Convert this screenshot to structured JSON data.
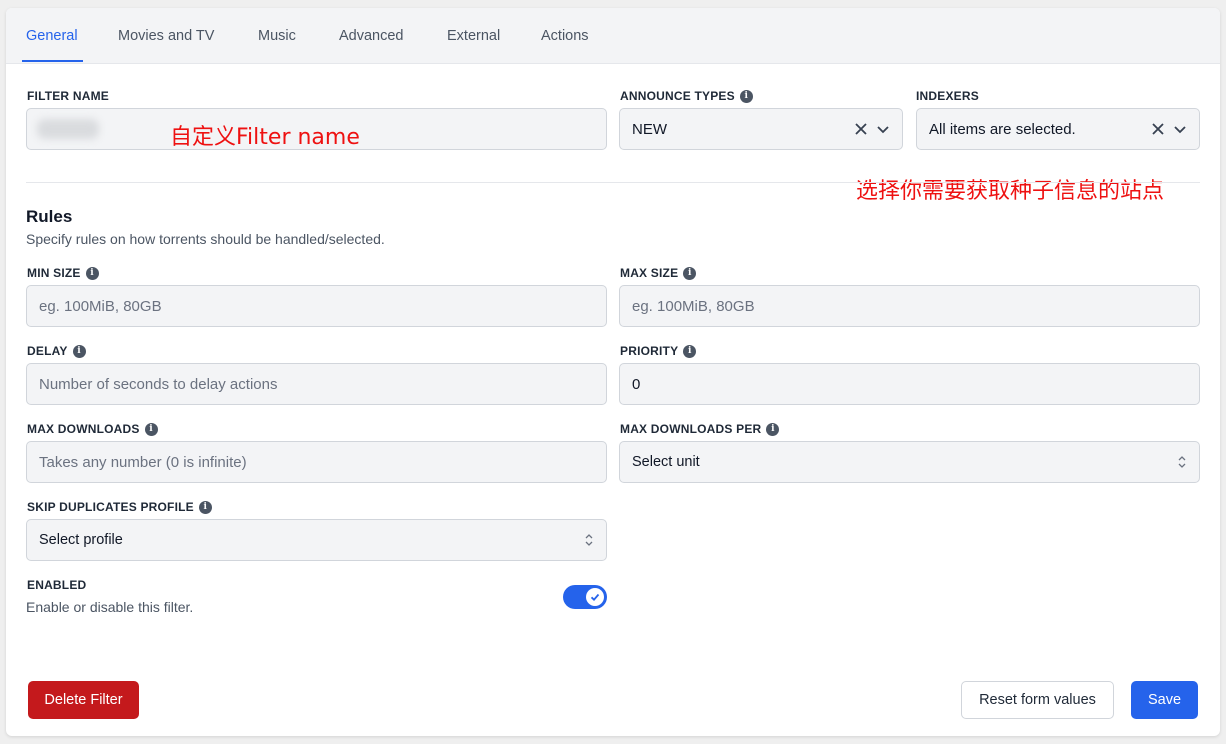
{
  "tabs": [
    {
      "label": "General",
      "active": true
    },
    {
      "label": "Movies and TV"
    },
    {
      "label": "Music"
    },
    {
      "label": "Advanced"
    },
    {
      "label": "External"
    },
    {
      "label": "Actions"
    }
  ],
  "filter_name": {
    "label": "FILTER NAME",
    "annotation": "自定义Filter name"
  },
  "announce_types": {
    "label": "ANNOUNCE TYPES",
    "value": "NEW"
  },
  "indexers": {
    "label": "INDEXERS",
    "value": "All items are selected.",
    "annotation": "选择你需要获取种子信息的站点"
  },
  "rules": {
    "title": "Rules",
    "description": "Specify rules on how torrents should be handled/selected.",
    "min_size": {
      "label": "MIN SIZE",
      "placeholder": "eg. 100MiB, 80GB"
    },
    "max_size": {
      "label": "MAX SIZE",
      "placeholder": "eg. 100MiB, 80GB"
    },
    "delay": {
      "label": "DELAY",
      "placeholder": "Number of seconds to delay actions"
    },
    "priority": {
      "label": "PRIORITY",
      "value": "0"
    },
    "max_downloads": {
      "label": "MAX DOWNLOADS",
      "placeholder": "Takes any number (0 is infinite)"
    },
    "max_downloads_per": {
      "label": "MAX DOWNLOADS PER",
      "value": "Select unit"
    },
    "skip_duplicates_profile": {
      "label": "SKIP DUPLICATES PROFILE",
      "value": "Select profile"
    }
  },
  "enabled": {
    "label": "ENABLED",
    "description": "Enable or disable this filter.",
    "on": true
  },
  "footer": {
    "delete_label": "Delete Filter",
    "reset_label": "Reset form values",
    "save_label": "Save"
  },
  "colors": {
    "accent": "#2563eb",
    "danger": "#c4191c",
    "annotation": "#ee1111"
  }
}
